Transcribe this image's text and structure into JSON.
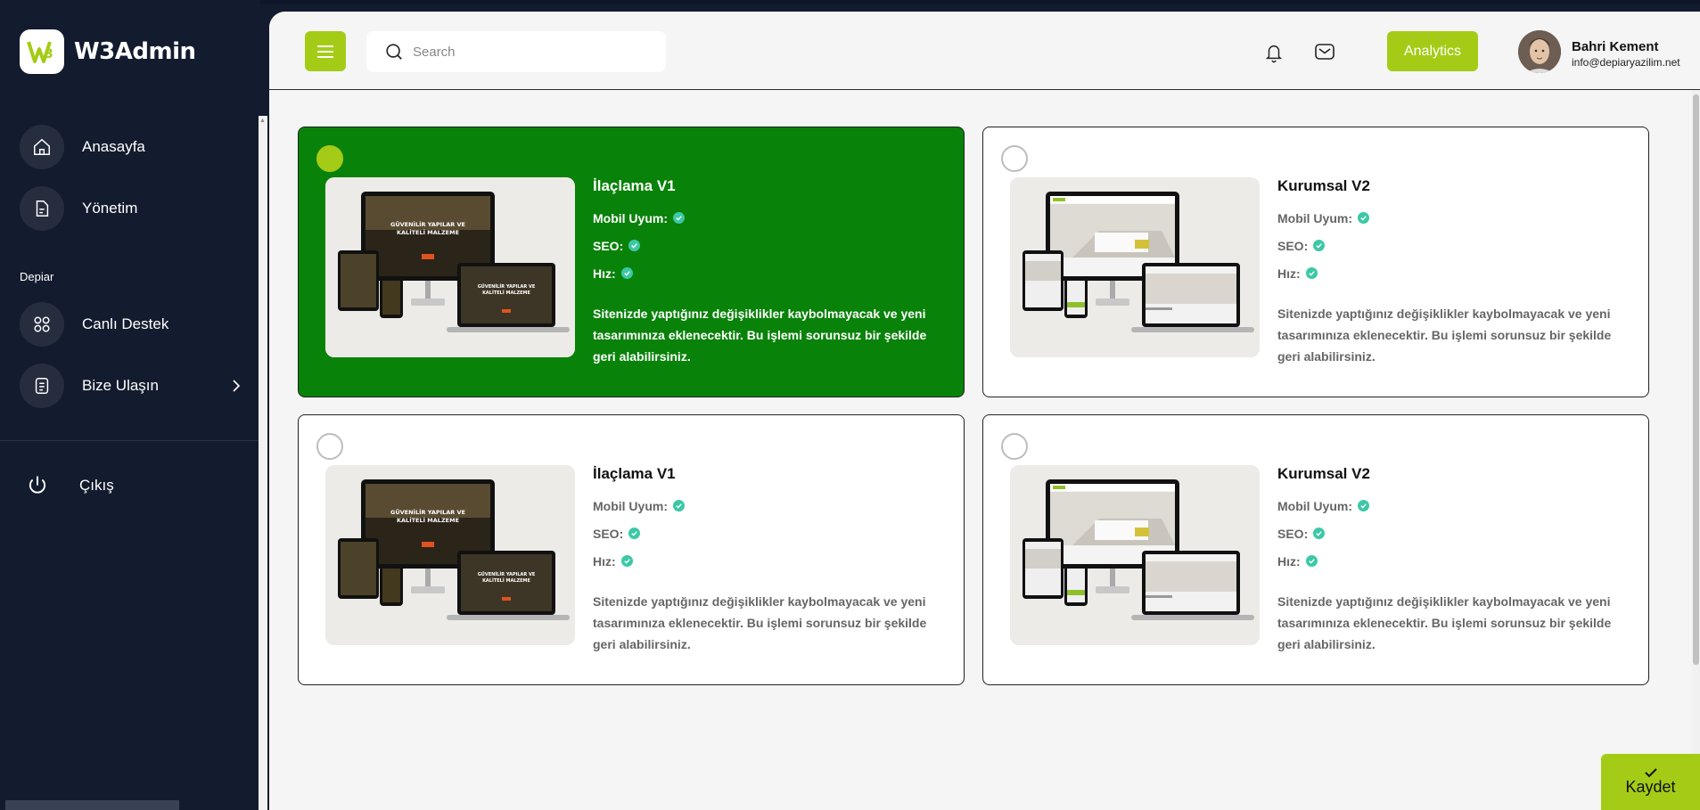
{
  "brand": {
    "name": "W3Admin",
    "logo_icon": "w3-logo"
  },
  "sidebar": {
    "items": [
      {
        "label": "Anasayfa",
        "icon": "home-icon"
      },
      {
        "label": "Yönetim",
        "icon": "document-icon"
      },
      {
        "label": "Canlı Destek",
        "icon": "grid-icon"
      },
      {
        "label": "Bize Ulaşın",
        "icon": "list-icon"
      }
    ],
    "section_label": "Depiar",
    "logout_label": "Çıkış"
  },
  "header": {
    "search_placeholder": "Search",
    "analytics_label": "Analytics",
    "user": {
      "name": "Bahri Kement",
      "email": "info@depiaryazilim.net"
    }
  },
  "cards": [
    {
      "title": "İlaçlama V1",
      "selected": true,
      "theme": "dark-hero"
    },
    {
      "title": "Kurumsal V2",
      "selected": false,
      "theme": "white-interior"
    },
    {
      "title": "İlaçlama V1",
      "selected": false,
      "theme": "dark-hero"
    },
    {
      "title": "Kurumsal V2",
      "selected": false,
      "theme": "white-interior"
    }
  ],
  "card_features": {
    "mobile": "Mobil Uyum:",
    "seo": "SEO:",
    "speed": "Hız:"
  },
  "card_description": "Sitenizde yaptığınız değişiklikler kaybolmayacak ve yeni tasarımınıza eklenecektir. Bu işlemi sorunsuz bir şekilde geri alabilirsiniz.",
  "mockup_text": "GÜVENİLİR YAPILAR VE KALİTELİ MALZEME",
  "save_label": "Kaydet",
  "colors": {
    "accent": "#a4cc17",
    "selected_card": "#098209",
    "sidebar": "#131b2e",
    "check": "#3cc8a6"
  }
}
